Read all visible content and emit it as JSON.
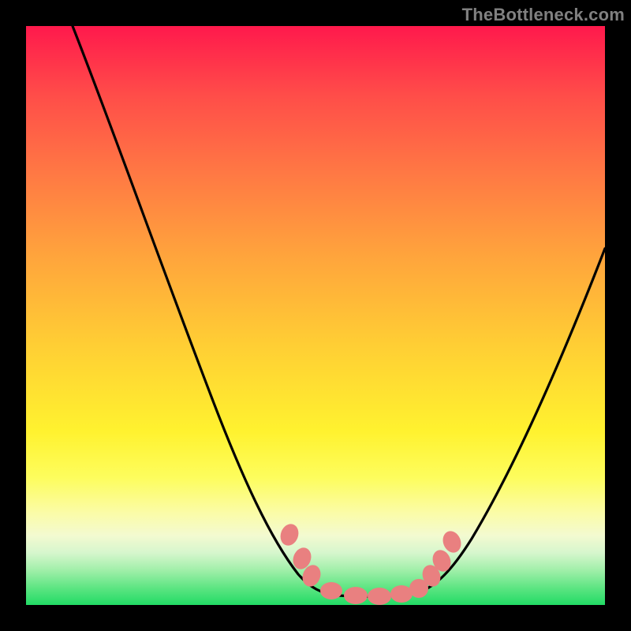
{
  "watermark": {
    "text": "TheBottleneck.com"
  },
  "chart_data": {
    "type": "line",
    "title": "",
    "xlabel": "",
    "ylabel": "",
    "xlim": [
      0,
      100
    ],
    "ylim": [
      0,
      100
    ],
    "background_gradient": {
      "top_color": "#ff194c",
      "bottom_color": "#22db65",
      "description": "vertical red-to-green gradient"
    },
    "series": [
      {
        "name": "bottleneck-curve",
        "color": "#000000",
        "x": [
          8,
          12,
          16,
          20,
          24,
          28,
          32,
          36,
          40,
          44,
          48,
          50,
          52,
          54,
          56,
          58,
          60,
          64,
          68,
          72,
          76,
          80,
          84,
          88,
          92,
          96,
          100
        ],
        "y": [
          100,
          92,
          84,
          76,
          68,
          60,
          52,
          44,
          36,
          28,
          20,
          16,
          12,
          8,
          5,
          3,
          2,
          2,
          2,
          3,
          7,
          14,
          23,
          32,
          42,
          52,
          62
        ]
      },
      {
        "name": "flat-minimum-markers",
        "type": "scatter",
        "color": "#e57373",
        "x": [
          44,
          46,
          48,
          52,
          56,
          60,
          64,
          68,
          70,
          72
        ],
        "y": [
          13,
          11,
          8,
          4,
          3,
          2,
          2,
          3,
          5,
          8
        ]
      }
    ]
  }
}
